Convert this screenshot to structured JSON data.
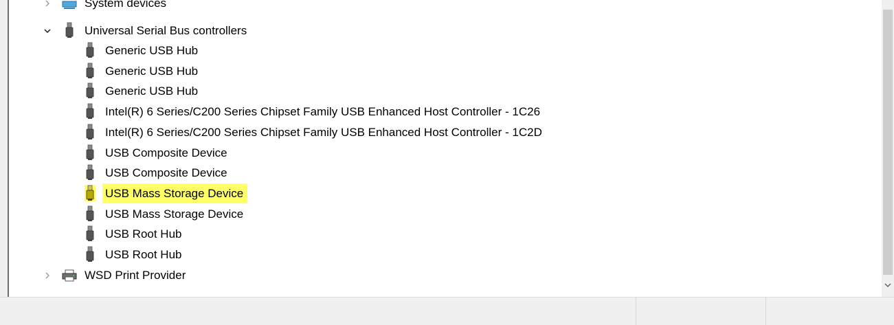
{
  "tree": {
    "system_devices": {
      "label": "System devices",
      "expanded": false,
      "icon": "monitor-icon"
    },
    "usb_controllers": {
      "label": "Universal Serial Bus controllers",
      "expanded": true,
      "icon": "usb-plug-icon",
      "children": [
        {
          "label": "Generic USB Hub"
        },
        {
          "label": "Generic USB Hub"
        },
        {
          "label": "Generic USB Hub"
        },
        {
          "label": "Intel(R) 6 Series/C200 Series Chipset Family USB Enhanced Host Controller - 1C26"
        },
        {
          "label": "Intel(R) 6 Series/C200 Series Chipset Family USB Enhanced Host Controller - 1C2D"
        },
        {
          "label": "USB Composite Device"
        },
        {
          "label": "USB Composite Device"
        },
        {
          "label": "USB Mass Storage Device",
          "highlighted": true
        },
        {
          "label": "USB Mass Storage Device"
        },
        {
          "label": "USB Root Hub"
        },
        {
          "label": "USB Root Hub"
        }
      ]
    },
    "wsd_print": {
      "label": "WSD Print Provider",
      "expanded": false,
      "icon": "printer-icon"
    }
  },
  "colors": {
    "highlight": "#ffff66",
    "selection_icon": "#b8a800"
  }
}
